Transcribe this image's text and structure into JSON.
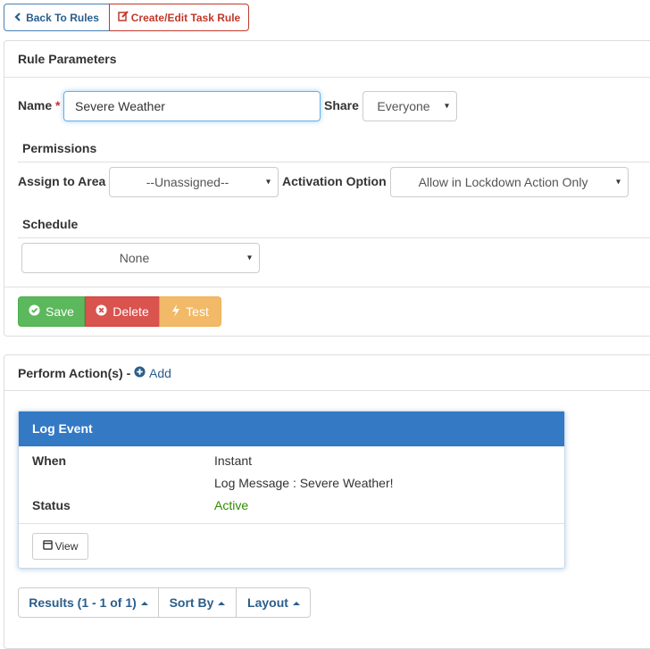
{
  "toolbar": {
    "back_label": "Back To Rules",
    "create_edit_label": "Create/Edit Task Rule"
  },
  "rule_params": {
    "title": "Rule Parameters",
    "name_label": "Name",
    "required_mark": "*",
    "name_value": "Severe Weather",
    "share_label": "Share",
    "share_value": "Everyone",
    "permissions_title": "Permissions",
    "assign_label": "Assign to Area",
    "assign_value": "--Unassigned--",
    "activation_label": "Activation Option",
    "activation_value": "Allow in Lockdown Action Only",
    "schedule_title": "Schedule",
    "schedule_value": "None"
  },
  "actions": {
    "save_label": "Save",
    "delete_label": "Delete",
    "test_label": "Test"
  },
  "perform": {
    "title": "Perform Action(s) -",
    "add_label": "Add",
    "card": {
      "title": "Log Event",
      "when_label": "When",
      "when_value": "Instant",
      "message": "Log Message : Severe Weather!",
      "status_label": "Status",
      "status_value": "Active",
      "view_label": "View"
    }
  },
  "pagination": {
    "results_label": "Results (1 - 1 of 1)",
    "sort_label": "Sort By",
    "layout_label": "Layout"
  },
  "colors": {
    "accent_blue": "#337ab7",
    "danger_red": "#d9534f",
    "success_green": "#5cb85c",
    "warning_orange": "#f0ad4e",
    "status_active": "#2e8b00",
    "link_blue": "#2a5e8c"
  },
  "icons": {
    "back": "chevron-left-icon",
    "edit": "edit-icon",
    "save": "check-circle-icon",
    "delete": "times-circle-icon",
    "test": "bolt-icon",
    "add": "plus-circle-icon",
    "view": "window-icon"
  }
}
